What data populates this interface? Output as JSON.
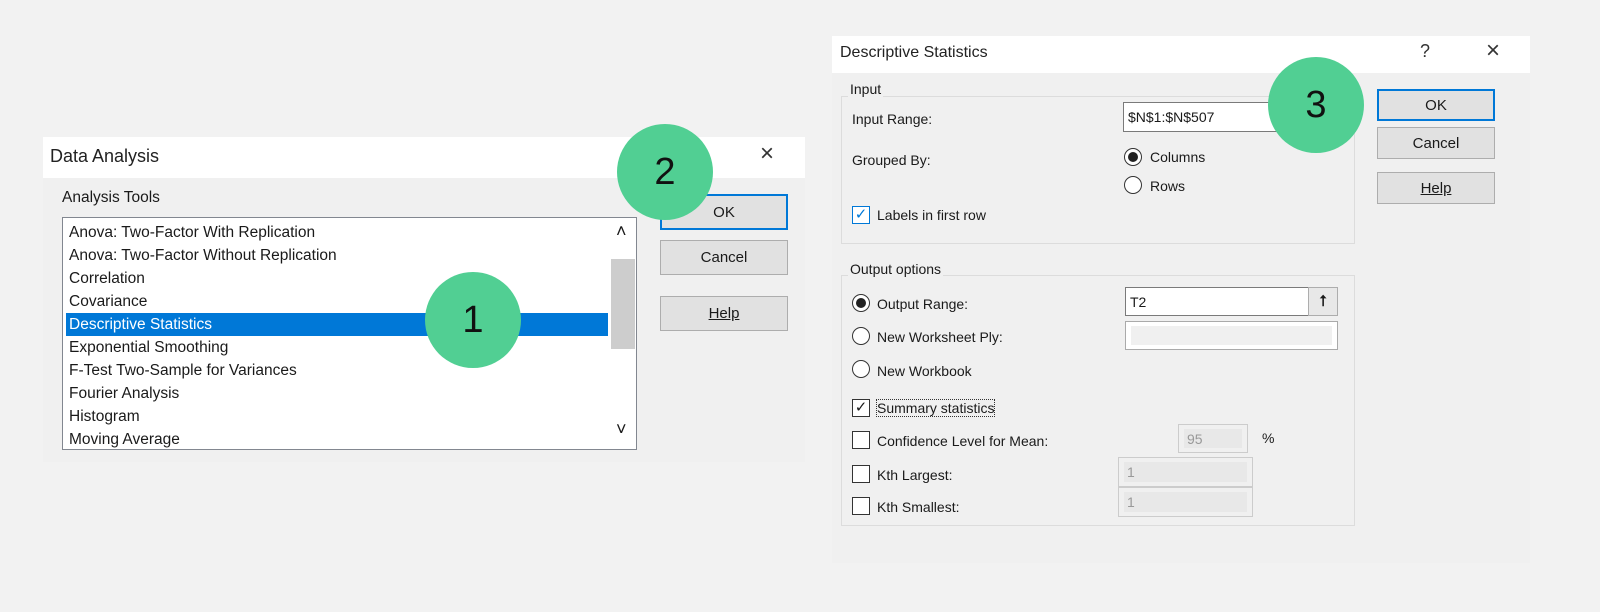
{
  "data_analysis": {
    "title": "Data Analysis",
    "close_icon": "×",
    "tools_label": "Analysis Tools",
    "items": [
      "Anova: Two-Factor With Replication",
      "Anova: Two-Factor Without Replication",
      "Correlation",
      "Covariance",
      "Descriptive Statistics",
      "Exponential Smoothing",
      "F-Test Two-Sample for Variances",
      "Fourier Analysis",
      "Histogram",
      "Moving Average"
    ],
    "selected_item": "Descriptive Statistics",
    "scroll_up_icon": "˄",
    "scroll_down_icon": "˅",
    "ok": "OK",
    "cancel": "Cancel",
    "help": "Help"
  },
  "descriptive_statistics": {
    "title": "Descriptive Statistics",
    "help_icon": "?",
    "close_icon": "×",
    "input_group": "Input",
    "input_range_label": "Input Range:",
    "input_range_value": "$N$1:$N$507",
    "grouped_by_label": "Grouped By:",
    "columns": "Columns",
    "rows": "Rows",
    "grouped_by_selected": "Columns",
    "labels_first_row": "Labels in first row",
    "labels_first_row_checked": true,
    "output_group": "Output options",
    "output_range_label": "Output Range:",
    "output_range_value": "T2",
    "collapse_icon": "⭡",
    "new_ws_ply": "New Worksheet Ply:",
    "new_workbook": "New Workbook",
    "summary_statistics": "Summary statistics",
    "summary_statistics_checked": true,
    "confidence_label": "Confidence Level for Mean:",
    "confidence_value": "95",
    "percent": "%",
    "kth_largest_label": "Kth Largest:",
    "kth_largest_value": "1",
    "kth_smallest_label": "Kth Smallest:",
    "kth_smallest_value": "1",
    "ok": "OK",
    "cancel": "Cancel",
    "help": "Help"
  },
  "steps": [
    "1",
    "2",
    "3"
  ],
  "colors": {
    "accent": "#0078d7",
    "step": "#51cf93"
  }
}
